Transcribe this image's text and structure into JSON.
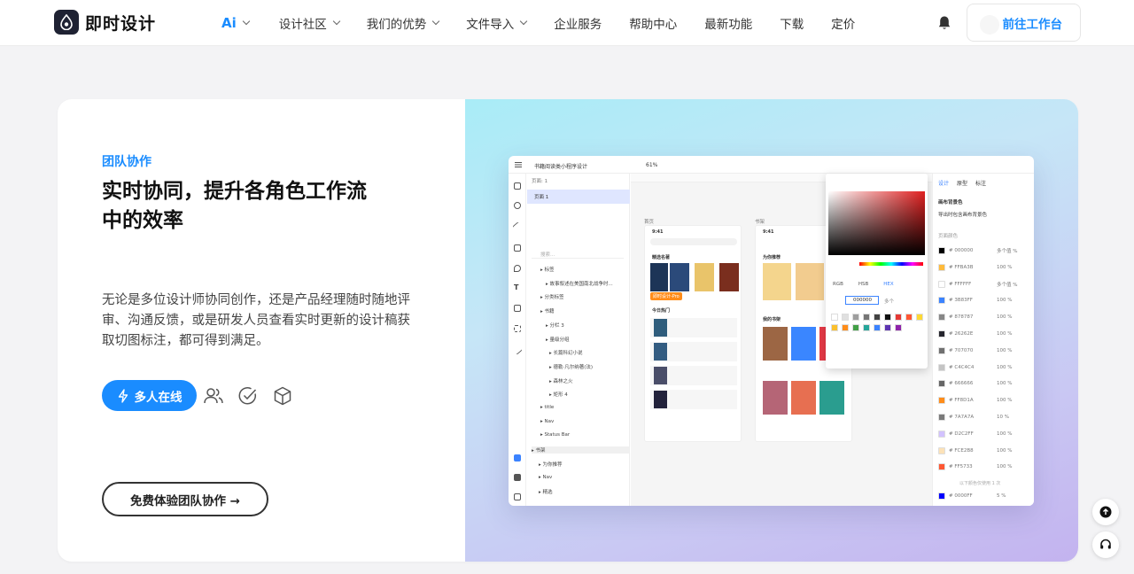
{
  "brand": {
    "name": "即时设计"
  },
  "nav": {
    "items": [
      {
        "label": "Ai",
        "has_dropdown": true
      },
      {
        "label": "设计社区",
        "has_dropdown": true
      },
      {
        "label": "我们的优势",
        "has_dropdown": true
      },
      {
        "label": "文件导入",
        "has_dropdown": true
      },
      {
        "label": "企业服务",
        "has_dropdown": false
      },
      {
        "label": "帮助中心",
        "has_dropdown": false
      },
      {
        "label": "最新功能",
        "has_dropdown": false
      },
      {
        "label": "下载",
        "has_dropdown": false
      },
      {
        "label": "定价",
        "has_dropdown": false
      }
    ],
    "workspace_button": "前往工作台",
    "icons": [
      "bell-icon"
    ]
  },
  "hero": {
    "kicker": "团队协作",
    "headline": "实时协同，提升各角色工作流中的效率",
    "description": "无论是多位设计师协同创作，还是产品经理随时随地评审、沟通反馈，或是研发人员查看实时更新的设计稿获取切图标注，都可得到满足。",
    "online_button": "多人在线",
    "feature_icons": [
      "users-icon",
      "check-circle-icon",
      "cube-icon"
    ],
    "try_button": "免费体验团队协作 →"
  },
  "preview": {
    "file_title": "书籍阅读类小程序设计",
    "zoom": "61%",
    "page_count_label": "页面: 1",
    "page_name": "页面 1",
    "search_placeholder": "搜索...",
    "layers": [
      "标签",
      "故事叙述在美国南北战争时...",
      "分类标签",
      "书籍",
      "分栏 3",
      "量级分组",
      "长篇科幻小说",
      "德勒·凡尔纳著(法)",
      "森林之火",
      "矩形 4",
      "title",
      "Nav",
      "Status Bar",
      "书架",
      "为你推荐",
      "Nav",
      "精选"
    ],
    "canvas_labels": [
      "首页",
      "书架"
    ],
    "phone_time": "9:41",
    "home_sections": [
      "精选名著",
      "经典名著",
      "畅销作品",
      "今日热门"
    ],
    "shelf_sections": [
      "为你推荐",
      "我的书架",
      "书品系统"
    ],
    "selection_badge": "即时设计-Pro",
    "color_modes": [
      "RGB",
      "HSB",
      "HEX"
    ],
    "hex_value": "000000",
    "multi_label": "多个",
    "right_tabs": [
      "设计",
      "原型",
      "标注"
    ],
    "canvas_bg_label": "画布背景色",
    "export_bg_label": "导出时包含画布背景色",
    "page_colors_label": "页面颜色",
    "colors": [
      {
        "hex": "000000",
        "opacity": "多个值"
      },
      {
        "hex": "FFBA3B",
        "opacity": "100"
      },
      {
        "hex": "FFFFFF",
        "opacity": "多个值"
      },
      {
        "hex": "3B83FF",
        "opacity": "100"
      },
      {
        "hex": "878787",
        "opacity": "100"
      },
      {
        "hex": "26262E",
        "opacity": "100"
      },
      {
        "hex": "707070",
        "opacity": "100"
      },
      {
        "hex": "C4C4C4",
        "opacity": "100"
      },
      {
        "hex": "666666",
        "opacity": "100"
      },
      {
        "hex": "FF8D1A",
        "opacity": "100"
      },
      {
        "hex": "7A7A7A",
        "opacity": "10"
      },
      {
        "hex": "D2C2FF",
        "opacity": "100"
      },
      {
        "hex": "FCE2B8",
        "opacity": "100"
      },
      {
        "hex": "FF5733",
        "opacity": "100"
      },
      {
        "hex": "0000FF",
        "opacity": "5"
      }
    ],
    "used_once_label": "以下颜色仅使用 1 次"
  },
  "colors": {
    "accent": "#1A8CFF",
    "dark": "#111111"
  }
}
